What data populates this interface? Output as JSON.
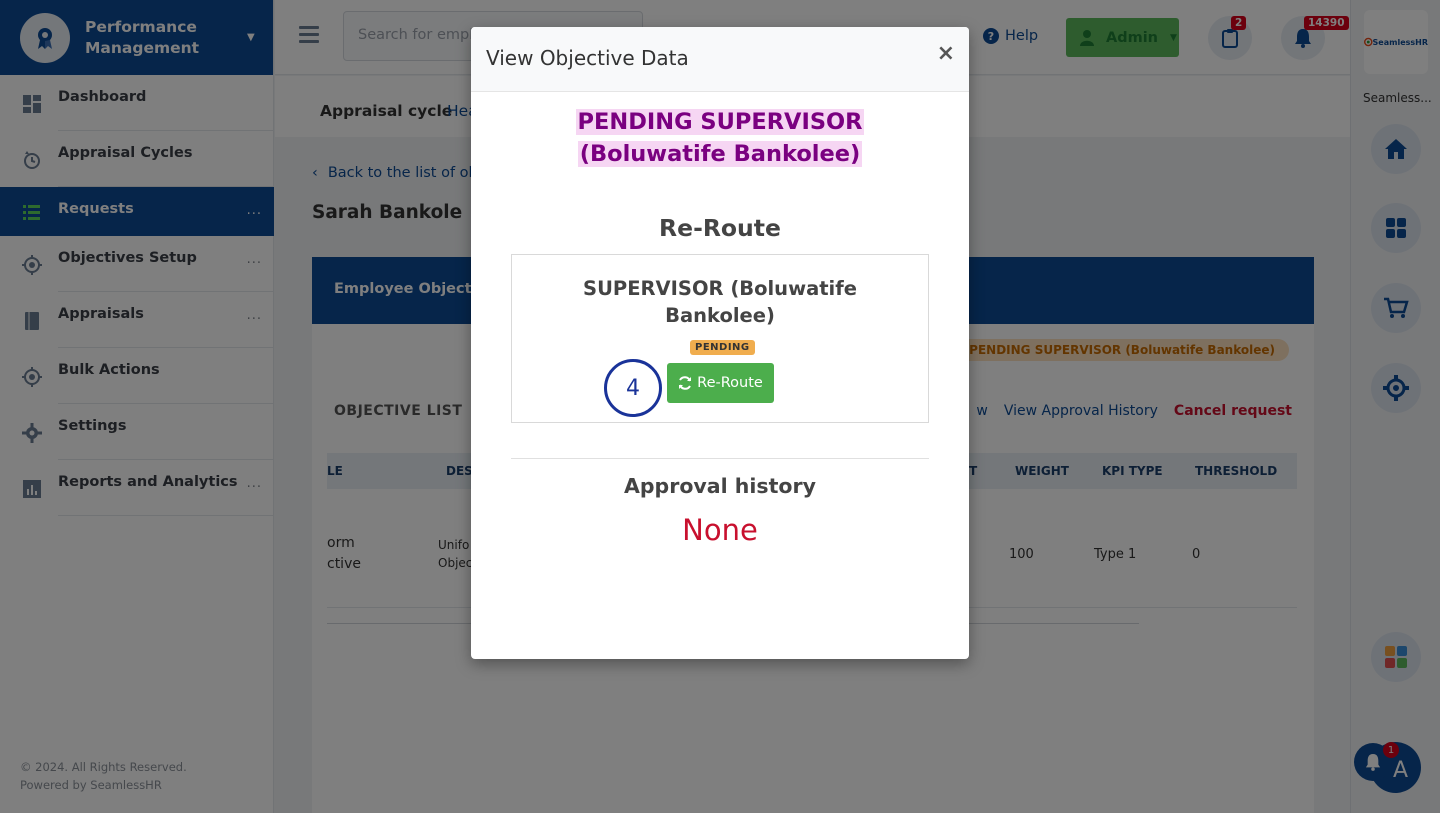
{
  "brand": {
    "title": "Performance Management"
  },
  "sidebar": {
    "items": [
      {
        "label": "Dashboard",
        "dots": ""
      },
      {
        "label": "Appraisal Cycles",
        "dots": ""
      },
      {
        "label": "Requests",
        "dots": "..."
      },
      {
        "label": "Objectives Setup",
        "dots": "..."
      },
      {
        "label": "Appraisals",
        "dots": "..."
      },
      {
        "label": "Bulk Actions",
        "dots": ""
      },
      {
        "label": "Settings",
        "dots": ""
      },
      {
        "label": "Reports and Analytics",
        "dots": "..."
      }
    ],
    "active": "Requests",
    "footer_line1": "© 2024. All Rights Reserved.",
    "footer_line2": "Powered by SeamlessHR"
  },
  "topbar": {
    "search_placeholder": "Search for empl",
    "help_label": "Help",
    "admin_label": "Admin",
    "tasks_count": "2",
    "notifications_count": "14390"
  },
  "rightrail": {
    "logo_text": "SeamlessHR",
    "label": "Seamless..."
  },
  "main": {
    "cycle_label": "Appraisal cycle",
    "cycle_link": "Hea",
    "back_link": "Back to the list of ob",
    "person_name": "Sarah Bankole",
    "card_title": "Employee Objective",
    "workflow_pill": "rkflow: PENDING SUPERVISOR (Boluwatife Bankolee)",
    "objective_list": "OBJECTIVE LIST",
    "view_fragment": "w",
    "view_history": "View Approval History",
    "cancel_request": "Cancel request",
    "table": {
      "headers": [
        "LE",
        "DES",
        "T",
        "WEIGHT",
        "KPI TYPE",
        "THRESHOLD"
      ],
      "row": {
        "title_line1": "orm",
        "title_line2": "ctive",
        "desc_line1": "Unifo",
        "desc_line2": "Objec",
        "weight": "100",
        "kpi_type": "Type 1",
        "threshold": "0"
      }
    }
  },
  "modal": {
    "title": "View Objective Data",
    "close": "×",
    "status_line1": "PENDING SUPERVISOR",
    "status_line2": "(Boluwatife Bankolee)",
    "reroute_heading": "Re-Route",
    "supervisor_line1": "SUPERVISOR (Boluwatife",
    "supervisor_line2": "Bankolee)",
    "pending_badge": "PENDING",
    "reroute_button": "Re-Route",
    "step_number": "4",
    "approval_heading": "Approval history",
    "approval_value": "None"
  },
  "floating": {
    "avatar_letter": "A",
    "bell_count": "1"
  },
  "colors": {
    "brand": "#0d4a94",
    "success": "#4cae4c",
    "danger": "#c8102e",
    "status_purple": "#7a0080"
  }
}
